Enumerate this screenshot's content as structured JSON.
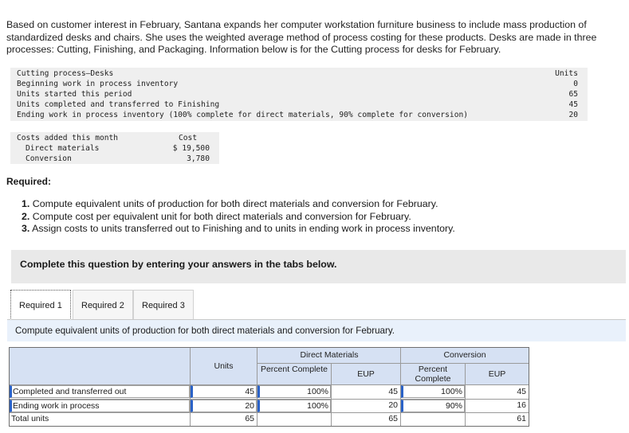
{
  "intro": "Based on customer interest in February, Santana expands her computer workstation furniture business to include mass production of standardized desks and chairs. She uses the weighted average method of process costing for these products. Desks are made in three processes: Cutting, Finishing, and Packaging. Information below is for the Cutting process for desks for February.",
  "info": {
    "title": "Cutting process—Desks",
    "units_header": "Units",
    "rows": [
      {
        "label": "Beginning work in process inventory",
        "units": "0"
      },
      {
        "label": "Units started this period",
        "units": "65"
      },
      {
        "label": "Units completed and transferred to Finishing",
        "units": "45"
      },
      {
        "label": "Ending work in process inventory (100% complete for direct materials, 90% complete for conversion)",
        "units": "20"
      }
    ]
  },
  "costs": {
    "title": "Costs added this month",
    "cost_header": "Cost",
    "rows": [
      {
        "label": "Direct materials",
        "cost": "$ 19,500"
      },
      {
        "label": "Conversion",
        "cost": "3,780"
      }
    ]
  },
  "required": {
    "heading": "Required:",
    "items": [
      {
        "num": "1.",
        "text": " Compute equivalent units of production for both direct materials and conversion for February."
      },
      {
        "num": "2.",
        "text": " Compute cost per equivalent unit for both direct materials and conversion for February."
      },
      {
        "num": "3.",
        "text": " Assign costs to units transferred out to Finishing and to units in ending work in process inventory."
      }
    ]
  },
  "complete_bar": "Complete this question by entering your answers in the tabs below.",
  "tabs": [
    "Required 1",
    "Required 2",
    "Required 3"
  ],
  "active_tab": 0,
  "instruction": "Compute equivalent units of production for both direct materials and conversion for February.",
  "table": {
    "col_units": "Units",
    "group_dm": "Direct Materials",
    "group_conv": "Conversion",
    "col_pct": "Percent Complete",
    "col_eup": "EUP",
    "rows": [
      {
        "label": "Completed and transferred out",
        "units": "45",
        "dm_pct": "100%",
        "dm_eup": "45",
        "conv_pct": "100%",
        "conv_eup": "45"
      },
      {
        "label": "Ending work in process",
        "units": "20",
        "dm_pct": "100%",
        "dm_eup": "20",
        "conv_pct": "90%",
        "conv_eup": "16"
      },
      {
        "label": "Total units",
        "units": "65",
        "dm_pct": "",
        "dm_eup": "65",
        "conv_pct": "",
        "conv_eup": "61"
      }
    ]
  }
}
